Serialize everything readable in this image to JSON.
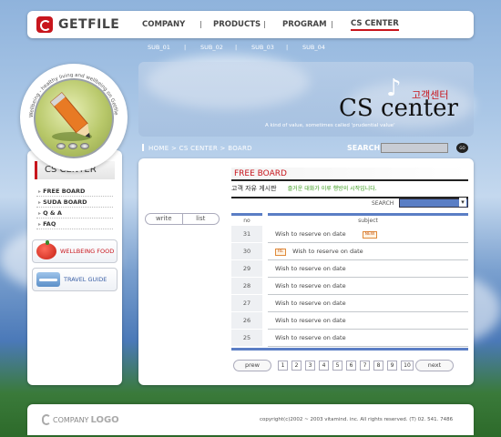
{
  "header": {
    "logo_text": "GETFILE",
    "nav": [
      "COMPANY",
      "PRODUCTS",
      "PROGRAM",
      "CS CENTER"
    ],
    "subnav": [
      "SUB_01",
      "SUB_02",
      "SUB_03",
      "SUB_04"
    ]
  },
  "left": {
    "ring_text": "Wellbeing - healthy living and wellbeing on Getfile",
    "section_title": "CS CENTER",
    "menu": [
      "FREE BOARD",
      "SUDA BOARD",
      "Q & A",
      "FAQ"
    ],
    "banner_food": "WELLBEING FOOD",
    "banner_travel": "TRAVEL GUIDE"
  },
  "hero": {
    "korean": "고객센터",
    "title": "CS center",
    "tagline": "A kind of value, sometimes called 'prudential value'"
  },
  "breadcrumb": "HOME > CS CENTER > BOARD",
  "search": {
    "label": "SEARCH",
    "go_label": "GO"
  },
  "board": {
    "write_label": "write",
    "list_label": "list",
    "title": "FREE BOARD",
    "subtitle": "고객 자유 게시판",
    "highlight": "즐거운 대화가 이루 행방의 시작입니다.",
    "search_label": "SEARCH",
    "col_no": "no",
    "col_subject": "subject",
    "rows": [
      {
        "no": "31",
        "subject": "Wish to reserve on date",
        "badge_after": "NEW"
      },
      {
        "no": "30",
        "subject": "Wish to reserve on date",
        "badge_before": "RE"
      },
      {
        "no": "29",
        "subject": "Wish to reserve on date"
      },
      {
        "no": "28",
        "subject": "Wish to reserve on date"
      },
      {
        "no": "27",
        "subject": "Wish to reserve on date"
      },
      {
        "no": "26",
        "subject": "Wish to reserve on date"
      },
      {
        "no": "25",
        "subject": "Wish to reserve on date"
      }
    ],
    "prev_label": "prew",
    "next_label": "next",
    "pages": [
      "1",
      "2",
      "3",
      "4",
      "5",
      "6",
      "7",
      "8",
      "9",
      "10"
    ]
  },
  "footer": {
    "logo_small": "COMPANY",
    "logo_big": "LOGO",
    "copyright": "copyright(c)2002 ~ 2003 vitamind. inc.  All rights reserved. (T) 02. 541. 7486"
  },
  "colors": {
    "accent_red": "#c8161d",
    "accent_blue": "#5b7ec5"
  }
}
